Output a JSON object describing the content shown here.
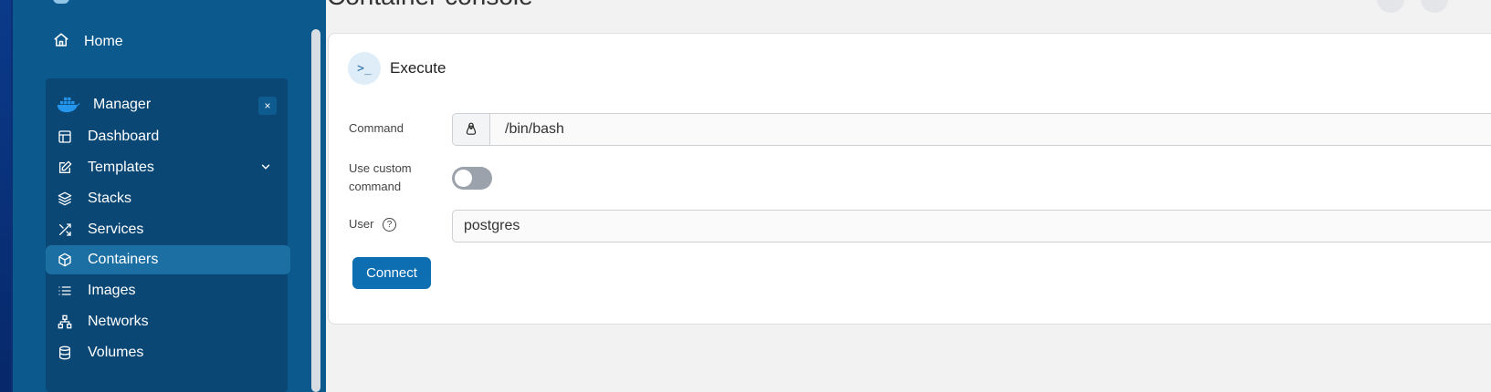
{
  "page": {
    "title": "Container console"
  },
  "sidebar": {
    "home_label": "Home",
    "environment": {
      "name": "Manager",
      "close_label": "×"
    },
    "items": [
      {
        "label": "Dashboard",
        "icon": "dashboard-icon"
      },
      {
        "label": "Templates",
        "icon": "edit-icon",
        "has_submenu": true
      },
      {
        "label": "Stacks",
        "icon": "layers-icon"
      },
      {
        "label": "Services",
        "icon": "shuffle-icon"
      },
      {
        "label": "Containers",
        "icon": "box-icon",
        "active": true
      },
      {
        "label": "Images",
        "icon": "list-icon"
      },
      {
        "label": "Networks",
        "icon": "network-icon"
      },
      {
        "label": "Volumes",
        "icon": "database-icon"
      }
    ],
    "colors": {
      "background": "#0c5a8d",
      "panel": "#0a4775",
      "active": "#1b6fa3"
    }
  },
  "execute": {
    "heading": "Execute",
    "badge_glyph": ">_",
    "command_label": "Command",
    "command_value": "/bin/bash",
    "custom_command_label_line1": "Use custom",
    "custom_command_label_line2": "command",
    "custom_command_enabled": false,
    "user_label": "User",
    "user_help": "?",
    "user_value": "postgres",
    "connect_label": "Connect"
  },
  "theme": {
    "accent": "#0d6eb2"
  }
}
